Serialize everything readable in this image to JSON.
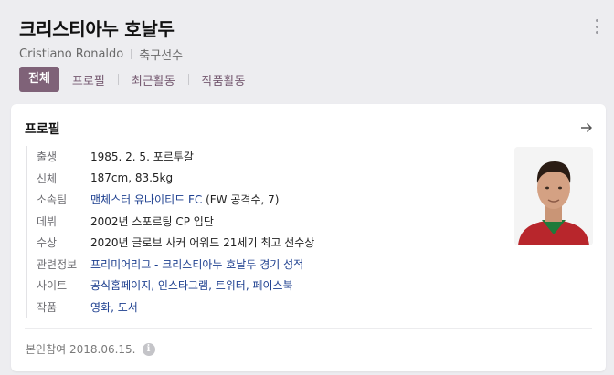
{
  "header": {
    "title": "크리스티아누 호날두",
    "name_en": "Cristiano Ronaldo",
    "occupation": "축구선수",
    "tabs": [
      {
        "label": "전체",
        "active": true
      },
      {
        "label": "프로필",
        "active": false
      },
      {
        "label": "최근활동",
        "active": false
      },
      {
        "label": "작품활동",
        "active": false
      }
    ]
  },
  "profile": {
    "title": "프로필",
    "rows": [
      {
        "label": "출생",
        "value": "1985. 2. 5. 포르투갈"
      },
      {
        "label": "신체",
        "value": "187cm, 83.5kg"
      },
      {
        "label": "소속팀",
        "value_link": "맨체스터 유나이티드 FC",
        "value_rest": " (FW 공격수, 7)"
      },
      {
        "label": "데뷔",
        "value": "2002년 스포르팅 CP 입단"
      },
      {
        "label": "수상",
        "value": "2020년 글로브 사커 어워드 21세기 최고 선수상"
      },
      {
        "label": "관련정보",
        "value_link": "프리미어리그 - 크리스티아누 호날두 경기 성적"
      },
      {
        "label": "사이트",
        "value_link": "공식홈페이지, 인스타그램, 트위터, 페이스북"
      },
      {
        "label": "작품",
        "value_link": "영화, 도서"
      }
    ],
    "footer": "본인참여 2018.06.15.",
    "footer_icon": "info-icon",
    "arrow_icon": "arrow-right-icon"
  },
  "colors": {
    "accent": "#7f6278",
    "link": "#1d3f8f",
    "background": "#ededf0"
  }
}
